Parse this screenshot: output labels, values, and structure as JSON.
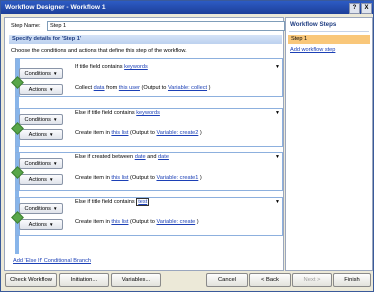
{
  "window": {
    "title": "Workflow Designer - Workflow 1",
    "help_glyph": "?",
    "close_glyph": "X"
  },
  "step": {
    "name_label": "Step Name:",
    "name_value": "Step 1",
    "specify_header": "Specify details for 'Step 1'",
    "choose_text": "Choose the conditions and actions that define this step of the workflow."
  },
  "buttons": {
    "conditions": "Conditions",
    "actions": "Actions",
    "arrow": "▼"
  },
  "branches": [
    {
      "condition": {
        "prefix": "If title field contains ",
        "link": "keywords",
        "suffix": ""
      },
      "action": {
        "prefix": "Collect ",
        "link1": "data",
        "mid1": " from ",
        "link2": "this user",
        "mid2": " (Output to ",
        "link3": "Variable: collect",
        "suffix": " )"
      }
    },
    {
      "condition": {
        "prefix": "Else if title field contains ",
        "link": "keywords",
        "suffix": ""
      },
      "action": {
        "prefix": "Create item in ",
        "link1": "this list",
        "mid1": " (Output to ",
        "link2": "Variable: create2",
        "suffix": " )"
      }
    },
    {
      "condition": {
        "prefix": "Else if created between ",
        "link": "date",
        "mid": " and ",
        "link2": "date"
      },
      "action": {
        "prefix": "Create item in ",
        "link1": "this list",
        "mid1": " (Output to ",
        "link2": "Variable: create1",
        "suffix": " )"
      }
    },
    {
      "condition": {
        "prefix": "Else if title field contains ",
        "link": "test",
        "suffix": ""
      },
      "action": {
        "prefix": "Create item in ",
        "link1": "this list",
        "mid1": " (Output to ",
        "link2": "Variable: create",
        "suffix": " )"
      }
    }
  ],
  "add_else_link": "Add 'Else If' Conditional Branch",
  "sidebar": {
    "title": "Workflow Steps",
    "steps": [
      "Step 1"
    ],
    "add_step": "Add workflow step"
  },
  "footer": {
    "check_workflow": "Check Workflow",
    "initiation": "Initiation...",
    "variables": "Variables...",
    "cancel": "Cancel",
    "back": "< Back",
    "next": "Next >",
    "finish": "Finish"
  },
  "colors": {
    "title_bar": "#1d3f99",
    "link": "#1c40b6",
    "selected_step": "#f9c77a",
    "branch_lane": "#88b5ea",
    "diamond": "#58a64a"
  }
}
